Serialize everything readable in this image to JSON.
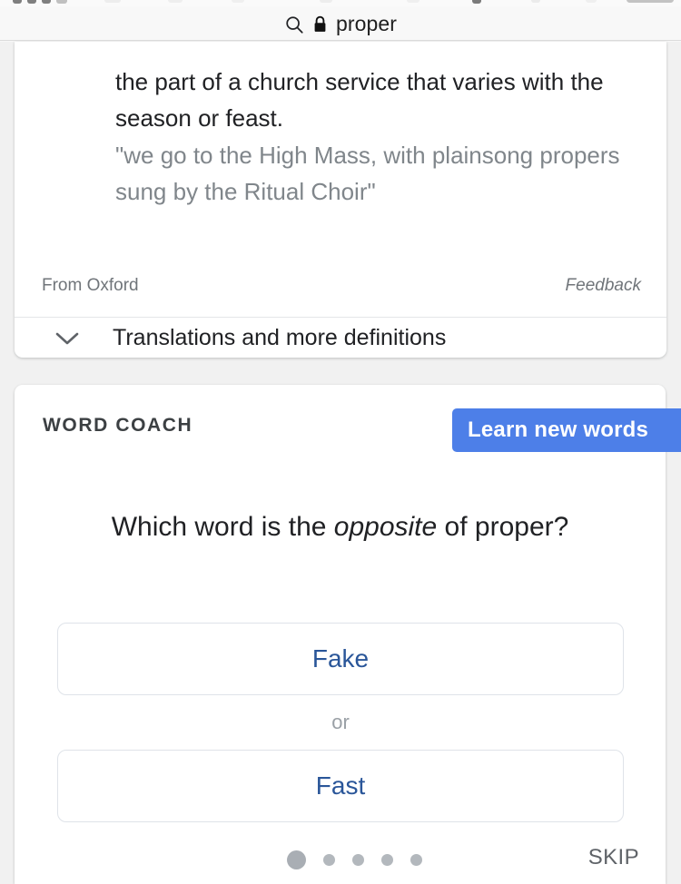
{
  "browser": {
    "chrome_strip_visible": true
  },
  "search": {
    "search_icon": "search-icon",
    "lock_icon": "lock-icon",
    "query": "proper"
  },
  "definition_card": {
    "definition": "the part of a church service that varies with the season or feast.",
    "example": "\"we go to the High Mass, with plainsong propers sung by the Ritual Choir\"",
    "source_label": "From Oxford",
    "feedback_label": "Feedback",
    "expand_icon": "chevron-down-icon",
    "translations_label": "Translations and more definitions"
  },
  "word_coach": {
    "title": "WORD COACH",
    "learn_button_label": "Learn new words",
    "question_prefix": "Which word is the ",
    "question_emphasis": "opposite",
    "question_suffix": " of proper?",
    "answers": [
      {
        "label": "Fake"
      },
      {
        "label": "Fast"
      }
    ],
    "or_label": "or",
    "skip_label": "SKIP",
    "progress": {
      "total": 5,
      "current": 1
    }
  },
  "colors": {
    "accent_blue": "#4d7fe8",
    "answer_text_blue": "#2a5699",
    "page_background": "#f1f1f1",
    "card_background": "#ffffff",
    "muted_text": "#80868b",
    "dot_gray": "#b3b8bd"
  }
}
